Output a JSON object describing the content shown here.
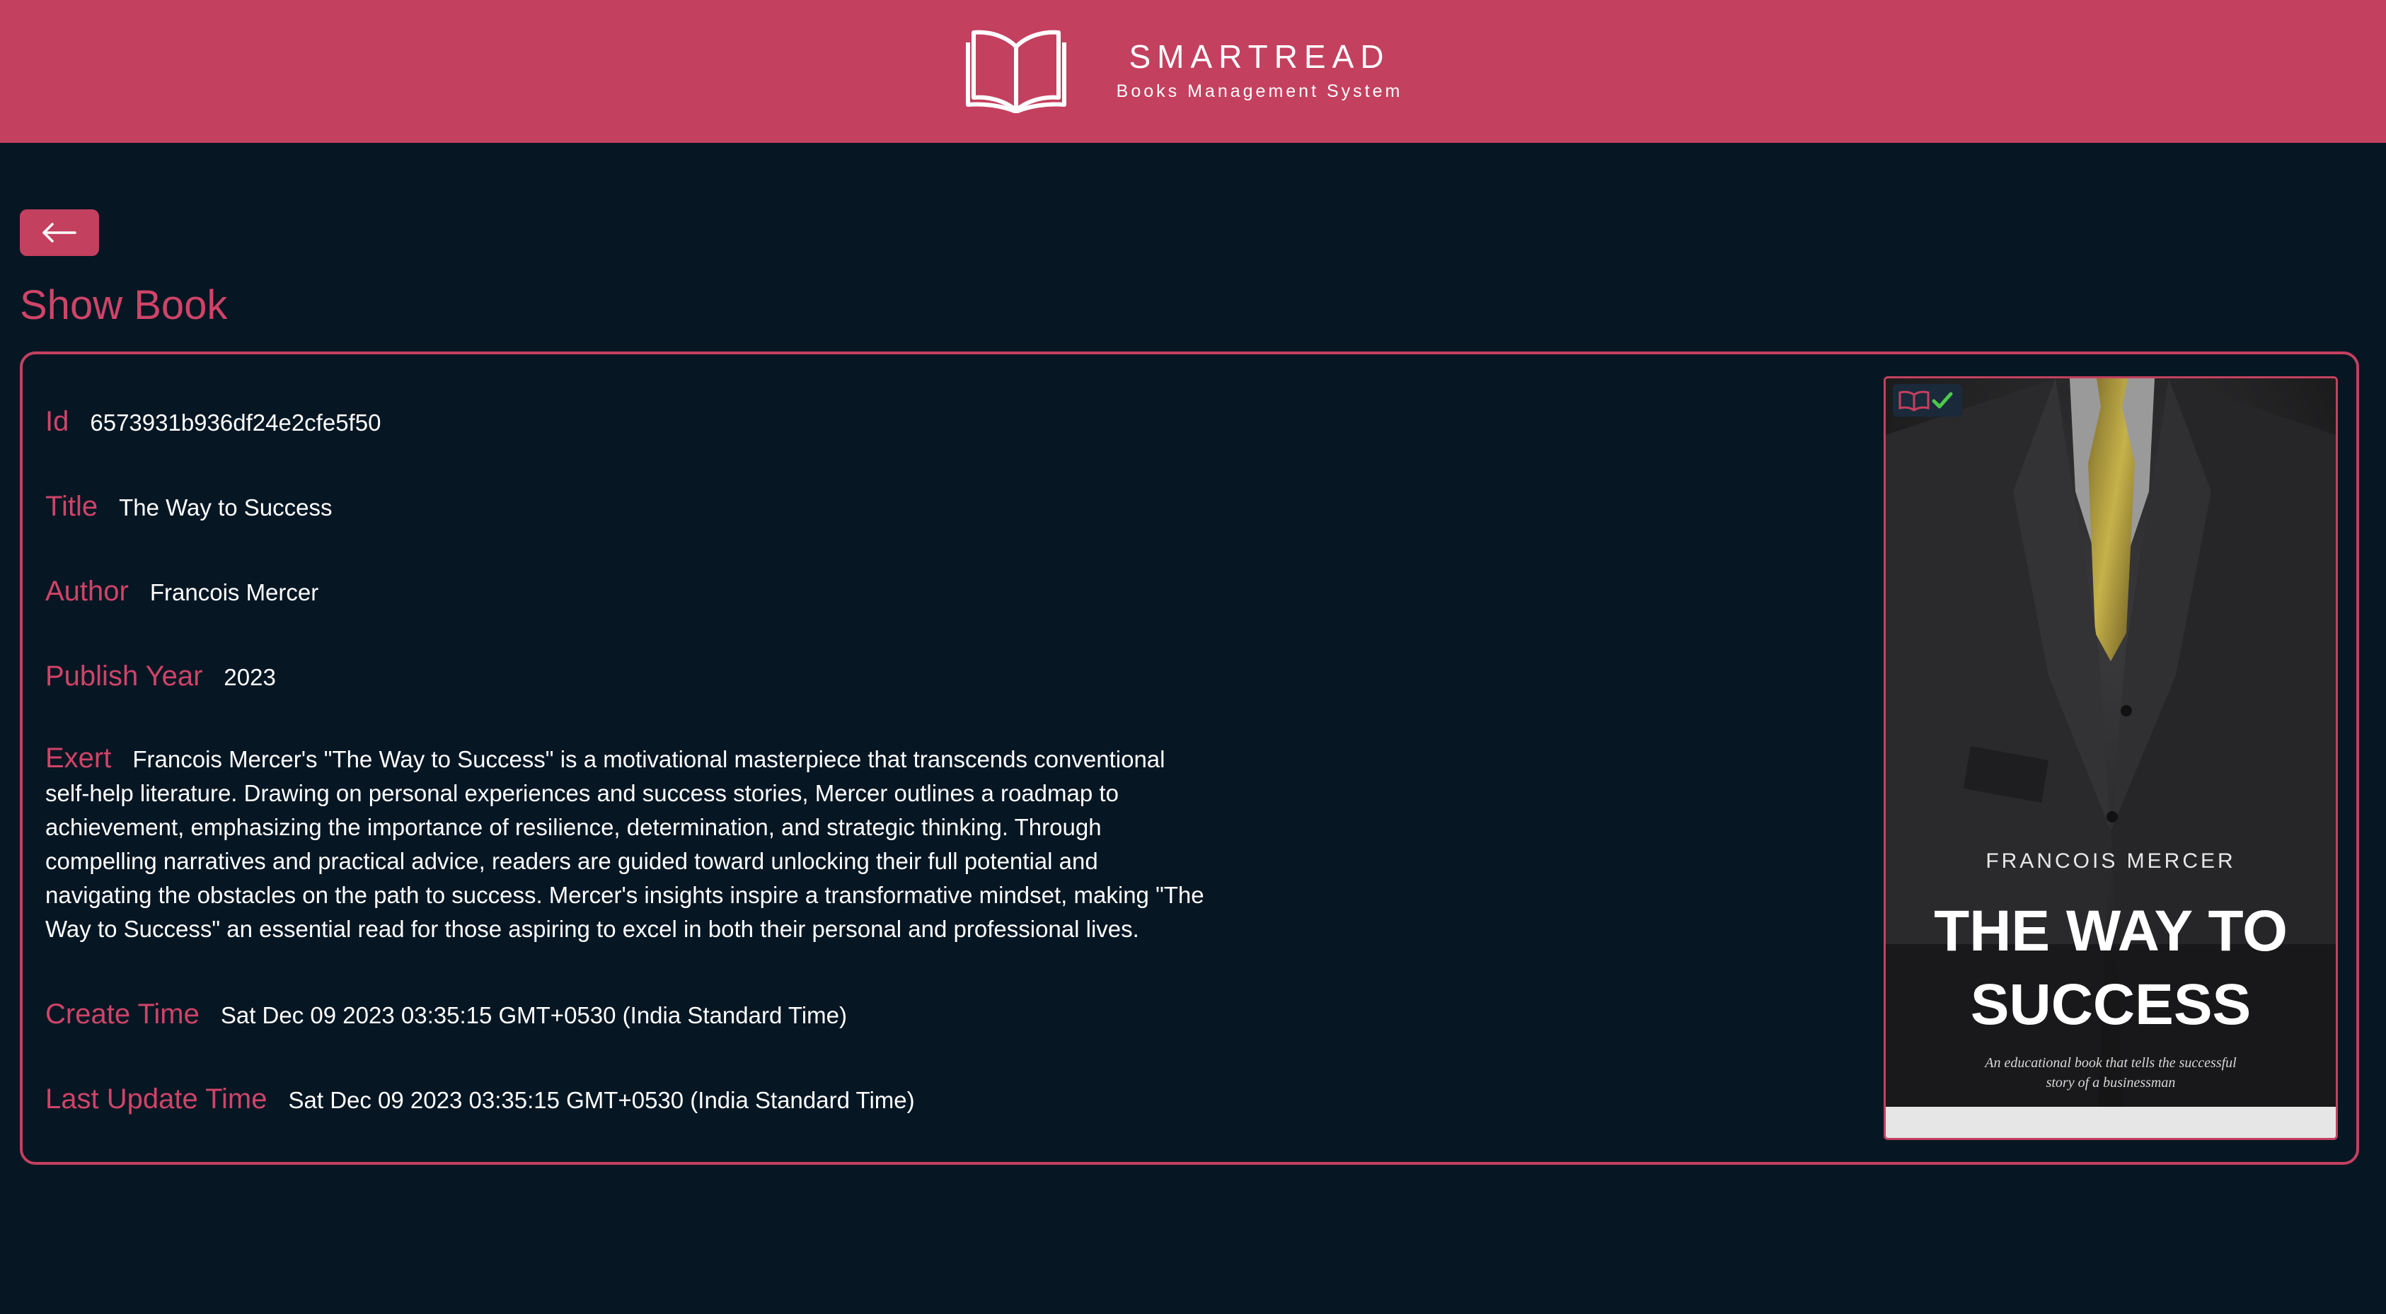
{
  "header": {
    "brand": "SMARTREAD",
    "subtitle": "Books Management System",
    "logo_icon": "open-book-icon",
    "color": "#c4405f"
  },
  "back_button": {
    "icon": "arrow-left-icon"
  },
  "page_title": "Show Book",
  "book": {
    "id_label": "Id",
    "id": "6573931b936df24e2cfe5f50",
    "title_label": "Title",
    "title": "The Way to Success",
    "author_label": "Author",
    "author": "Francois Mercer",
    "year_label": "Publish Year",
    "year": "2023",
    "excerpt_label": "Exert",
    "excerpt": "Francois Mercer's \"The Way to Success\" is a motivational masterpiece that transcends conventional self-help literature. Drawing on personal experiences and success stories, Mercer outlines a roadmap to achievement, emphasizing the importance of resilience, determination, and strategic thinking. Through compelling narratives and practical advice, readers are guided toward unlocking their full potential and navigating the obstacles on the path to success. Mercer's insights inspire a transformative mindset, making \"The Way to Success\" an essential read for those aspiring to excel in both their personal and professional lives.",
    "create_label": "Create Time",
    "create_time": "Sat Dec 09 2023 03:35:15 GMT+0530 (India Standard Time)",
    "update_label": "Last Update Time",
    "update_time": "Sat Dec 09 2023 03:35:15 GMT+0530 (India Standard Time)"
  },
  "cover": {
    "author": "FRANCOIS MERCER",
    "title_line1": "THE WAY TO",
    "title_line2": "SUCCESS",
    "subtitle_line1": "An educational book that tells the successful",
    "subtitle_line2": "story of a businessman"
  },
  "colors": {
    "background": "#061623",
    "accent": "#c4405f",
    "label": "#cf4468"
  }
}
